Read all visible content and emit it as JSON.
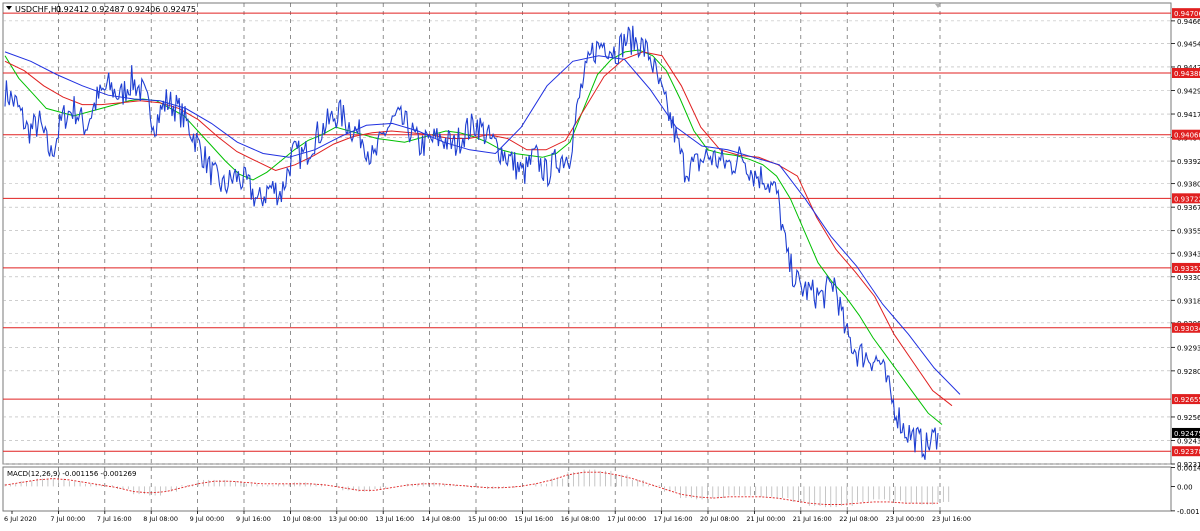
{
  "header": {
    "symbol_label": "USDCHF,H1",
    "ohlc_text": "0.92412 0.92487 0.92406 0.92475"
  },
  "macd_panel": {
    "label": "MACD(12,26,9) -0.001156 -0.001269"
  },
  "colors": {
    "price": "#1f3fd1",
    "ma_fast": "#00c000",
    "ma_mid": "#e02020",
    "ma_slow": "#2030e0",
    "level_line": "#e02020",
    "current_price_box": "#000000",
    "grid": "#b0b0b0",
    "macd_hist": "#b8b8b8",
    "macd_signal": "#e02020"
  },
  "chart_data": {
    "type": "line",
    "symbol": "USDCHF",
    "timeframe": "H1",
    "ylim": [
      0.9231,
      0.9476
    ],
    "y_ticks": [
      "0.94665",
      "0.94545",
      "0.94420",
      "0.94295",
      "0.94170",
      "0.94045",
      "0.93920",
      "0.93800",
      "0.93675",
      "0.93550",
      "0.93430",
      "0.93305",
      "0.93180",
      "0.93060",
      "0.92930",
      "0.92805",
      "0.92560",
      "0.92435",
      "0.92310"
    ],
    "x_ticks": [
      "6 Jul 2020",
      "7 Jul 00:00",
      "7 Jul 16:00",
      "8 Jul 08:00",
      "9 Jul 00:00",
      "9 Jul 16:00",
      "10 Jul 08:00",
      "13 Jul 00:00",
      "13 Jul 16:00",
      "14 Jul 08:00",
      "15 Jul 00:00",
      "15 Jul 16:00",
      "16 Jul 08:00",
      "17 Jul 00:00",
      "17 Jul 16:00",
      "20 Jul 08:00",
      "21 Jul 00:00",
      "21 Jul 16:00",
      "22 Jul 08:00",
      "23 Jul 00:00",
      "23 Jul 16:00"
    ],
    "horizontal_levels": [
      "0.94706",
      "0.94388",
      "0.94060",
      "0.93722",
      "0.93352",
      "0.93034",
      "0.92655",
      "0.92378"
    ],
    "current_price": "0.92475",
    "price_series": [
      0.9429,
      0.9422,
      0.9408,
      0.9412,
      0.9395,
      0.9415,
      0.942,
      0.941,
      0.9425,
      0.9432,
      0.9426,
      0.9435,
      0.9428,
      0.9412,
      0.9424,
      0.942,
      0.941,
      0.9398,
      0.9385,
      0.9378,
      0.9384,
      0.938,
      0.937,
      0.9378,
      0.9375,
      0.9396,
      0.9395,
      0.9405,
      0.9412,
      0.9418,
      0.941,
      0.9405,
      0.9392,
      0.9408,
      0.9415,
      0.941,
      0.94,
      0.9403,
      0.9404,
      0.94,
      0.9408,
      0.9412,
      0.9404,
      0.9398,
      0.9392,
      0.9385,
      0.9395,
      0.9385,
      0.9393,
      0.9395,
      0.943,
      0.945,
      0.9455,
      0.945,
      0.9457,
      0.9455,
      0.9448,
      0.9428,
      0.941,
      0.9388,
      0.939,
      0.9395,
      0.9392,
      0.939,
      0.9395,
      0.9385,
      0.9383,
      0.9375,
      0.9338,
      0.9325,
      0.9322,
      0.932,
      0.9328,
      0.93,
      0.929,
      0.9288,
      0.9285,
      0.9265,
      0.925,
      0.9245,
      0.924,
      0.92475
    ],
    "series": [
      {
        "values": [
          0.9448,
          0.9436,
          0.9428,
          0.942,
          0.9418,
          0.9416,
          0.9418,
          0.942,
          0.9422,
          0.9424,
          0.9425,
          0.9424,
          0.942,
          0.9416,
          0.9408,
          0.94,
          0.9392,
          0.9385,
          0.9382,
          0.9386,
          0.9392,
          0.9398,
          0.9403,
          0.9406,
          0.941,
          0.9408,
          0.9406,
          0.9404,
          0.9403,
          0.9402,
          0.9404,
          0.9406,
          0.9408,
          0.9407,
          0.9405,
          0.9402,
          0.9398,
          0.9396,
          0.9395,
          0.9394,
          0.9396,
          0.9402,
          0.942,
          0.9438,
          0.9446,
          0.945,
          0.9451,
          0.9448,
          0.944,
          0.9425,
          0.9408,
          0.9398,
          0.9396,
          0.9395,
          0.9393,
          0.939,
          0.9384,
          0.9372,
          0.9355,
          0.9338,
          0.9328,
          0.932,
          0.931,
          0.9298,
          0.9288,
          0.9278,
          0.9268,
          0.9258,
          0.9252
        ]
      },
      {
        "values": [
          0.9445,
          0.944,
          0.9432,
          0.9426,
          0.9422,
          0.9422,
          0.9423,
          0.9424,
          0.9423,
          0.942,
          0.9414,
          0.9405,
          0.9397,
          0.9392,
          0.9387,
          0.939,
          0.9395,
          0.9401,
          0.9405,
          0.9407,
          0.9408,
          0.9407,
          0.9406,
          0.9404,
          0.9404,
          0.9406,
          0.9404,
          0.9398,
          0.9398,
          0.9403,
          0.942,
          0.9437,
          0.9446,
          0.945,
          0.9448,
          0.9432,
          0.941,
          0.9398,
          0.9395,
          0.9394,
          0.939,
          0.9384,
          0.9362,
          0.9345,
          0.9333,
          0.932,
          0.93,
          0.9285,
          0.927,
          0.9262
        ]
      },
      {
        "values": [
          0.945,
          0.9445,
          0.9438,
          0.9432,
          0.9427,
          0.9425,
          0.9424,
          0.942,
          0.9412,
          0.9402,
          0.9396,
          0.9394,
          0.9398,
          0.9405,
          0.9411,
          0.9412,
          0.9408,
          0.9402,
          0.9398,
          0.9396,
          0.941,
          0.9432,
          0.9445,
          0.9448,
          0.9446,
          0.943,
          0.941,
          0.94,
          0.9398,
          0.9394,
          0.939,
          0.9372,
          0.9352,
          0.9336,
          0.9316,
          0.93,
          0.9282,
          0.9268
        ]
      }
    ],
    "macd": {
      "label": "MACD(12,26,9)",
      "main_value": "-0.001156",
      "signal_value": "-0.001269",
      "ylim": [
        -0.0019,
        0.0015
      ],
      "y_ticks": [
        "0.00146",
        "0.00",
        "-0.00189"
      ],
      "histogram": [
        0.0002,
        0.0004,
        0.0006,
        0.0006,
        0.0004,
        0.0002,
        0.0001,
        -0.0002,
        -0.0006,
        -0.0007,
        -0.0004,
        0.0001,
        0.0005,
        0.0005,
        0.0004,
        0.0002,
        0.0001,
        0.0002,
        0.0003,
        0.0002,
        0.0,
        -0.0003,
        -0.0004,
        -0.0002,
        0.0,
        0.0002,
        0.0003,
        0.0002,
        0.0001,
        -0.0001,
        -0.0002,
        -0.0001,
        0.0,
        0.0002,
        0.0006,
        0.0011,
        0.0013,
        0.0012,
        0.0009,
        0.0005,
        0.0001,
        -0.0004,
        -0.0009,
        -0.001,
        -0.0009,
        -0.0007,
        -0.0007,
        -0.0008,
        -0.0009,
        -0.0012,
        -0.0015,
        -0.0016,
        -0.0015,
        -0.0012,
        -0.001,
        -0.0011,
        -0.0013,
        -0.0014,
        -0.0012
      ],
      "signal": [
        0.0001,
        0.0003,
        0.0005,
        0.0006,
        0.0005,
        0.0003,
        0.0001,
        -0.0001,
        -0.0004,
        -0.0005,
        -0.0004,
        -0.0001,
        0.0002,
        0.0004,
        0.0004,
        0.0003,
        0.0002,
        0.0002,
        0.0002,
        0.0002,
        0.0001,
        -0.0001,
        -0.0003,
        -0.0003,
        -0.0001,
        0.0001,
        0.0002,
        0.0002,
        0.0001,
        0.0,
        -0.0001,
        -0.0001,
        0.0,
        0.0002,
        0.0005,
        0.0009,
        0.0011,
        0.0011,
        0.0009,
        0.0006,
        0.0002,
        -0.0002,
        -0.0006,
        -0.0008,
        -0.0009,
        -0.0008,
        -0.0008,
        -0.0008,
        -0.0009,
        -0.0011,
        -0.0013,
        -0.0014,
        -0.0014,
        -0.0013,
        -0.0012,
        -0.0012,
        -0.0013,
        -0.0013,
        -0.0013
      ]
    }
  }
}
